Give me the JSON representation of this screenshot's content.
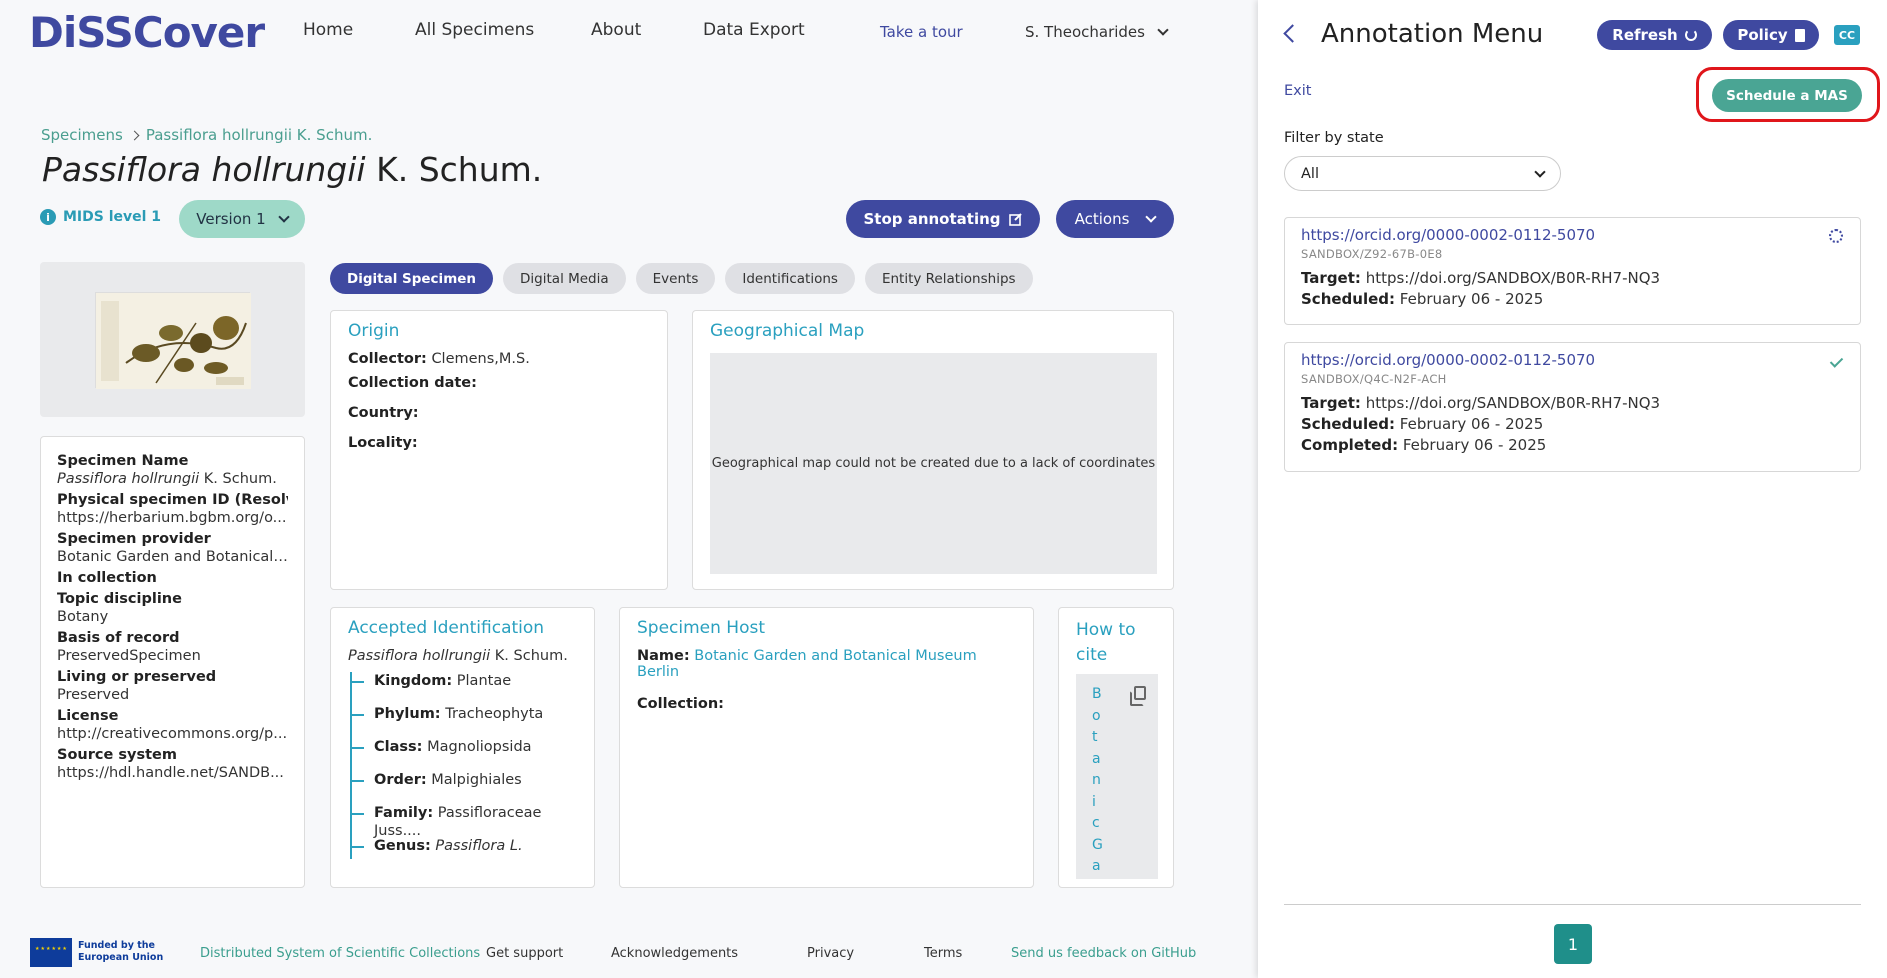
{
  "header": {
    "logo": "DiSSCover",
    "nav": [
      "Home",
      "All Specimens",
      "About",
      "Data Export"
    ],
    "tour": "Take a tour",
    "user": "S. Theocharides"
  },
  "breadcrumb": {
    "root": "Specimens",
    "current": "Passiflora hollrungii K. Schum."
  },
  "title": {
    "italic": "Passiflora hollrungii",
    "rest": " K. Schum."
  },
  "badges": {
    "mids": "MIDS level 1",
    "version": "Version 1"
  },
  "buttons": {
    "stop": "Stop annotating",
    "actions": "Actions"
  },
  "tabs": [
    "Digital Specimen",
    "Digital Media",
    "Events",
    "Identifications",
    "Entity Relationships"
  ],
  "meta": [
    {
      "label": "Specimen Name",
      "value": "Passiflora hollrungii K. Schum."
    },
    {
      "label": "Physical specimen ID (Resolvab",
      "value": "https://herbarium.bgbm.org/o..."
    },
    {
      "label": "Specimen provider",
      "value": "Botanic Garden and Botanical ..."
    },
    {
      "label": "In collection",
      "value": ""
    },
    {
      "label": "Topic discipline",
      "value": "Botany"
    },
    {
      "label": "Basis of record",
      "value": "PreservedSpecimen"
    },
    {
      "label": "Living or preserved",
      "value": "Preserved"
    },
    {
      "label": "License",
      "value": "http://creativecommons.org/p..."
    },
    {
      "label": "Source system",
      "value": "https://hdl.handle.net/SANDB..."
    }
  ],
  "origin": {
    "title": "Origin",
    "collector_label": "Collector:",
    "collector": "Clemens,M.S.",
    "date_label": "Collection date:",
    "country_label": "Country:",
    "locality_label": "Locality:"
  },
  "geo": {
    "title": "Geographical Map",
    "message": "Geographical map could not be created due to a lack of coordinates"
  },
  "accepted": {
    "title": "Accepted Identification",
    "name_italic": "Passiflora hollrungii",
    "name_rest": " K. Schum.",
    "taxa": [
      {
        "rank": "Kingdom:",
        "value": "Plantae"
      },
      {
        "rank": "Phylum:",
        "value": "Tracheophyta"
      },
      {
        "rank": "Class:",
        "value": "Magnoliopsida"
      },
      {
        "rank": "Order:",
        "value": "Malpighiales"
      },
      {
        "rank": "Family:",
        "value": "Passifloraceae Juss...."
      },
      {
        "rank": "Genus:",
        "value": "Passiflora L."
      }
    ]
  },
  "host": {
    "title": "Specimen Host",
    "name_label": "Name:",
    "name": "Botanic Garden and Botanical Museum Berlin",
    "collection_label": "Collection:"
  },
  "cite": {
    "title": "How to cite",
    "text": "BotanicGa"
  },
  "footer": {
    "eu": "Funded by the European Union",
    "links": [
      "Distributed System of Scientific Collections",
      "Get support",
      "Acknowledgements",
      "Privacy",
      "Terms",
      "Send us feedback on GitHub"
    ]
  },
  "panel": {
    "title": "Annotation Menu",
    "refresh": "Refresh",
    "policy": "Policy",
    "cc": "CC",
    "exit": "Exit",
    "schedule": "Schedule a MAS",
    "filter_label": "Filter by state",
    "filter_value": "All",
    "annotations": [
      {
        "link": "https://orcid.org/0000-0002-0112-5070",
        "id": "SANDBOX/Z92-67B-0E8",
        "target_label": "Target:",
        "target": "https://doi.org/SANDBOX/B0R-RH7-NQ3",
        "scheduled_label": "Scheduled:",
        "scheduled": "February 06 - 2025",
        "status": "running"
      },
      {
        "link": "https://orcid.org/0000-0002-0112-5070",
        "id": "SANDBOX/Q4C-N2F-ACH",
        "target_label": "Target:",
        "target": "https://doi.org/SANDBOX/B0R-RH7-NQ3",
        "scheduled_label": "Scheduled:",
        "scheduled": "February 06 - 2025",
        "completed_label": "Completed:",
        "completed": "February 06 - 2025",
        "status": "completed"
      }
    ],
    "page": "1"
  },
  "colors": {
    "primary": "#3f49a0",
    "accent": "#2aa0bf",
    "green": "#4aa594",
    "highlight": "#e0161b"
  }
}
